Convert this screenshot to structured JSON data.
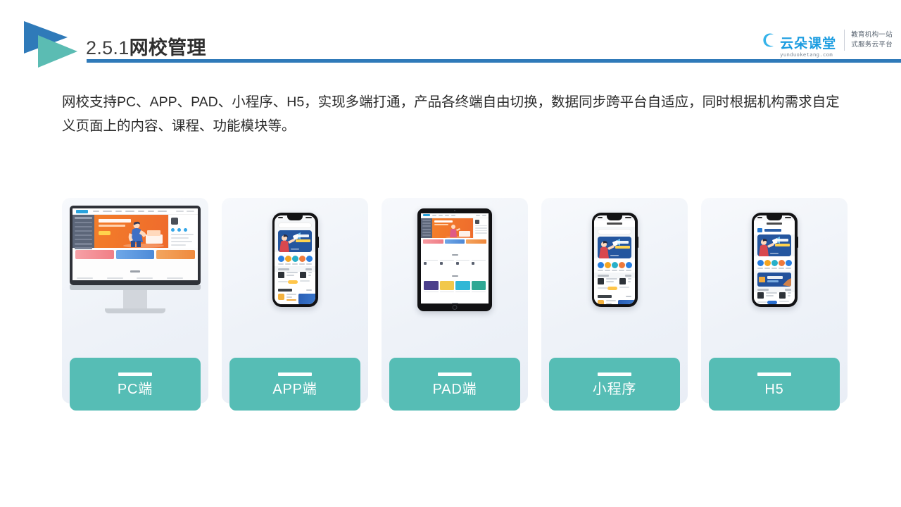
{
  "header": {
    "section_number": "2.5.1",
    "title_zh": "网校管理",
    "rule_color": "#2f7ab9",
    "logo_colors": {
      "blue": "#2f7ab9",
      "teal": "#5bbcb3"
    }
  },
  "brand": {
    "name": "云朵课堂",
    "url": "yunduoketang.com",
    "tagline_line1": "教育机构一站",
    "tagline_line2": "式服务云平台",
    "color": "#1b9ce0"
  },
  "body": {
    "paragraph": "网校支持PC、APP、PAD、小程序、H5，实现多端打通，产品各终端自由切换，数据同步跨平台自适应，同时根据机构需求自定义页面上的内容、课程、功能模块等。"
  },
  "cards": {
    "pill_color": "#56bdb5",
    "items": [
      {
        "label": "PC端",
        "device": "desktop"
      },
      {
        "label": "APP端",
        "device": "phone"
      },
      {
        "label": "PAD端",
        "device": "tablet"
      },
      {
        "label": "小程序",
        "device": "phone"
      },
      {
        "label": "H5",
        "device": "phone"
      }
    ]
  },
  "mock_colors": {
    "orange_banner": "#f0722b",
    "blue_banner": "#2457a8",
    "sidebar_slate": "#5c6679",
    "accent_blue": "#2aa3dd",
    "tablet_grid": [
      "#4b3f8c",
      "#f2c84b",
      "#31b7d6",
      "#2fa894",
      "#2b62b8",
      "#ef7a2b",
      "#4a515e",
      "#2d77c9",
      "#f0c94a",
      "#2f7ad0",
      "#28a77f",
      "#ef8130"
    ]
  }
}
